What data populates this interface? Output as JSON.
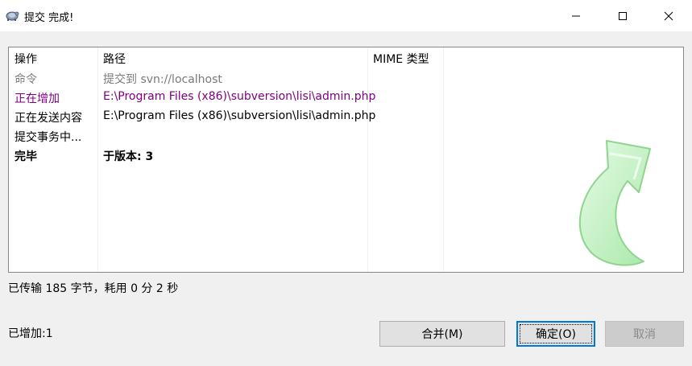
{
  "window": {
    "title": "提交 完成!",
    "controls": [
      "minimize-icon",
      "maximize-icon",
      "close-icon"
    ]
  },
  "log": {
    "columns": [
      "操作",
      "路径",
      "MIME 类型"
    ],
    "rows": [
      {
        "action": "命令",
        "path": "提交到 svn://localhost",
        "style": "gray"
      },
      {
        "action": "正在增加",
        "path": "E:\\Program Files (x86)\\subversion\\lisi\\admin.php",
        "style": "purple"
      },
      {
        "action": "正在发送内容",
        "path": "E:\\Program Files (x86)\\subversion\\lisi\\admin.php",
        "style": "normal"
      },
      {
        "action": "提交事务中...",
        "path": "",
        "style": "normal"
      },
      {
        "action": "完毕",
        "path": "于版本: 3",
        "style": "bold"
      }
    ]
  },
  "status": {
    "transfer": "已传输 185 字节，耗用 0 分 2 秒",
    "added": "已增加:1"
  },
  "buttons": {
    "merge": "合并(M)",
    "ok": "确定(O)",
    "cancel": "取消"
  },
  "colors": {
    "gray_text": "#7a7a7a",
    "purple_text": "#800080",
    "focus_border": "#0078d7",
    "arrow_fill": "#c8f5c8"
  }
}
